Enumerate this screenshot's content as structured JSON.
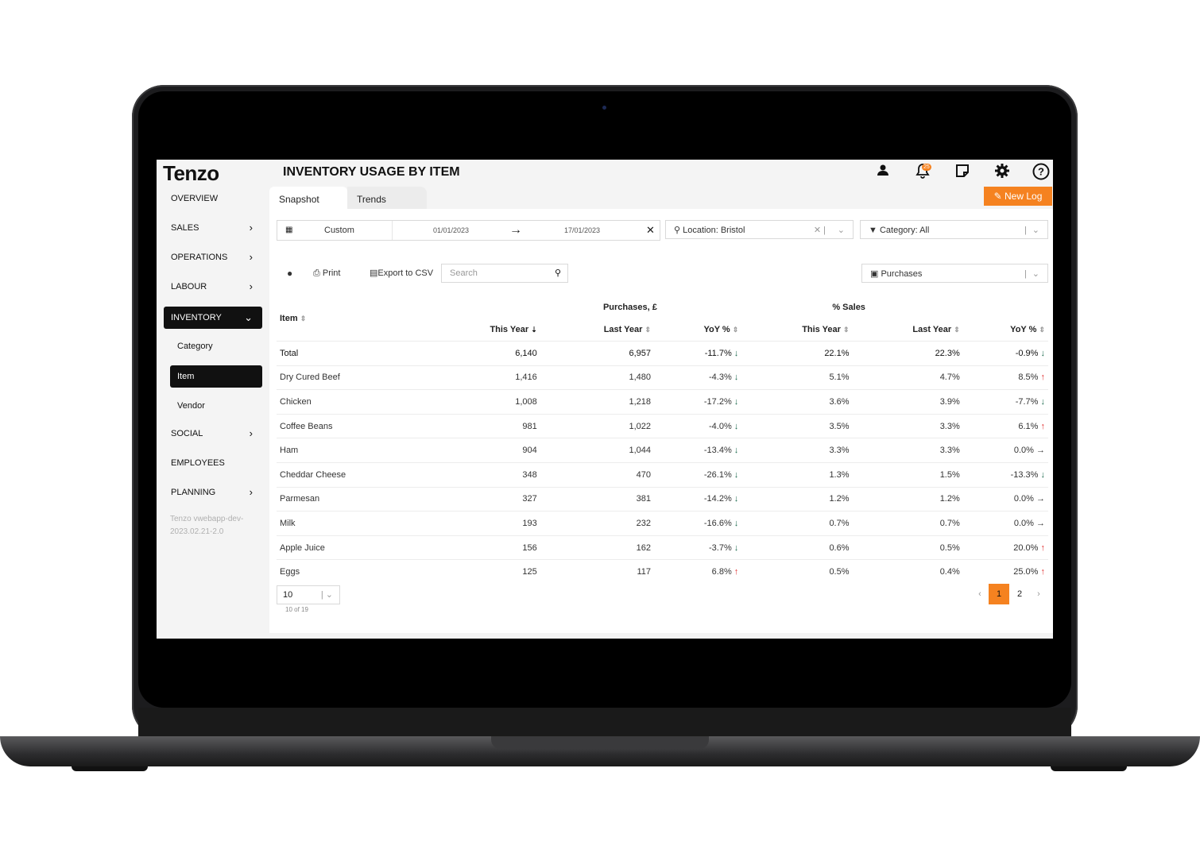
{
  "app": {
    "logo": "Tenzo",
    "title": "INVENTORY USAGE BY ITEM",
    "notification_count": "25",
    "new_log_label": "New Log"
  },
  "sidebar": {
    "items": [
      {
        "label": "OVERVIEW"
      },
      {
        "label": "SALES"
      },
      {
        "label": "OPERATIONS"
      },
      {
        "label": "LABOUR"
      },
      {
        "label": "INVENTORY"
      },
      {
        "label": "Category"
      },
      {
        "label": "Item"
      },
      {
        "label": "Vendor"
      },
      {
        "label": "SOCIAL"
      },
      {
        "label": "EMPLOYEES"
      },
      {
        "label": "PLANNING"
      }
    ],
    "version_line1": "Tenzo vwebapp-dev-",
    "version_line2": "2023.02.21-2.0"
  },
  "tabs": [
    {
      "label": "Snapshot"
    },
    {
      "label": "Trends"
    }
  ],
  "filters": {
    "date_mode": "Custom",
    "date_from": "01/01/2023",
    "date_to": "17/01/2023",
    "location": "Location: Bristol",
    "category": "Category: All",
    "metric": "Purchases"
  },
  "toolbar": {
    "print_label": "Print",
    "export_label": "Export to CSV",
    "search_placeholder": "Search"
  },
  "table": {
    "group_headers": [
      "Purchases, £",
      "% Sales"
    ],
    "columns": [
      "Item",
      "This Year",
      "Last Year",
      "YoY %",
      "This Year",
      "Last Year",
      "YoY %"
    ],
    "rows": [
      {
        "item": "Total",
        "p_ty": "6,140",
        "p_ly": "6,957",
        "p_yoy": "-11.7%",
        "p_dir": "down",
        "s_ty": "22.1%",
        "s_ly": "22.3%",
        "s_yoy": "-0.9%",
        "s_dir": "down"
      },
      {
        "item": "Dry Cured Beef",
        "p_ty": "1,416",
        "p_ly": "1,480",
        "p_yoy": "-4.3%",
        "p_dir": "down",
        "s_ty": "5.1%",
        "s_ly": "4.7%",
        "s_yoy": "8.5%",
        "s_dir": "up"
      },
      {
        "item": "Chicken",
        "p_ty": "1,008",
        "p_ly": "1,218",
        "p_yoy": "-17.2%",
        "p_dir": "down",
        "s_ty": "3.6%",
        "s_ly": "3.9%",
        "s_yoy": "-7.7%",
        "s_dir": "down"
      },
      {
        "item": "Coffee Beans",
        "p_ty": "981",
        "p_ly": "1,022",
        "p_yoy": "-4.0%",
        "p_dir": "down",
        "s_ty": "3.5%",
        "s_ly": "3.3%",
        "s_yoy": "6.1%",
        "s_dir": "up"
      },
      {
        "item": "Ham",
        "p_ty": "904",
        "p_ly": "1,044",
        "p_yoy": "-13.4%",
        "p_dir": "down",
        "s_ty": "3.3%",
        "s_ly": "3.3%",
        "s_yoy": "0.0%",
        "s_dir": "flat"
      },
      {
        "item": "Cheddar Cheese",
        "p_ty": "348",
        "p_ly": "470",
        "p_yoy": "-26.1%",
        "p_dir": "down",
        "s_ty": "1.3%",
        "s_ly": "1.5%",
        "s_yoy": "-13.3%",
        "s_dir": "down"
      },
      {
        "item": "Parmesan",
        "p_ty": "327",
        "p_ly": "381",
        "p_yoy": "-14.2%",
        "p_dir": "down",
        "s_ty": "1.2%",
        "s_ly": "1.2%",
        "s_yoy": "0.0%",
        "s_dir": "flat"
      },
      {
        "item": "Milk",
        "p_ty": "193",
        "p_ly": "232",
        "p_yoy": "-16.6%",
        "p_dir": "down",
        "s_ty": "0.7%",
        "s_ly": "0.7%",
        "s_yoy": "0.0%",
        "s_dir": "flat"
      },
      {
        "item": "Apple Juice",
        "p_ty": "156",
        "p_ly": "162",
        "p_yoy": "-3.7%",
        "p_dir": "down",
        "s_ty": "0.6%",
        "s_ly": "0.5%",
        "s_yoy": "20.0%",
        "s_dir": "up"
      },
      {
        "item": "Eggs",
        "p_ty": "125",
        "p_ly": "117",
        "p_yoy": "6.8%",
        "p_dir": "up",
        "s_ty": "0.5%",
        "s_ly": "0.4%",
        "s_yoy": "25.0%",
        "s_dir": "up"
      }
    ]
  },
  "pagination": {
    "page_size": "10",
    "count_text": "10 of 19",
    "pages": [
      "1",
      "2"
    ],
    "current_page": "1"
  },
  "colors": {
    "accent": "#f58220",
    "down": "#1d6b4f",
    "up": "#e03030",
    "nav_active": "#111111"
  }
}
